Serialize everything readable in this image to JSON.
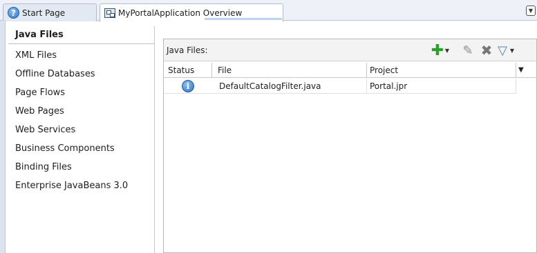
{
  "tabs": [
    {
      "label": "Start Page",
      "icon": "help-icon"
    },
    {
      "label": "MyPortalApplication Overview",
      "icon": "overview-icon"
    }
  ],
  "categories": [
    {
      "label": "Java Files",
      "active": true
    },
    {
      "label": "XML Files"
    },
    {
      "label": "Offline Databases"
    },
    {
      "label": "Page Flows"
    },
    {
      "label": "Web Pages"
    },
    {
      "label": "Web Services"
    },
    {
      "label": "Business Components"
    },
    {
      "label": "Binding Files"
    },
    {
      "label": "Enterprise JavaBeans 3.0"
    }
  ],
  "main": {
    "toolbar_label": "Java Files:",
    "columns": [
      "Status",
      "File",
      "Project"
    ],
    "rows": [
      {
        "status": "info-icon",
        "file": "DefaultCatalogFilter.java",
        "project": "Portal.jpr"
      }
    ]
  },
  "colors": {
    "accent": "#2f76c6",
    "add": "#2aa02a"
  }
}
